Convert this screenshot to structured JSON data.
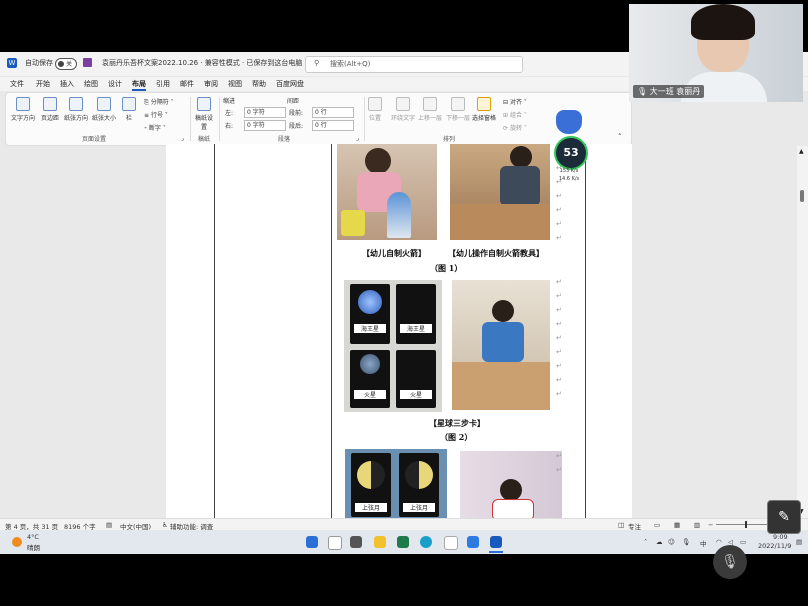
{
  "window": {
    "autosave_label": "自动保存",
    "autosave_state": "关",
    "doc_title": "袁丽丹乐吾杯文案2022.10.26 · 兼容性模式 · 已保存到这台电脑",
    "search_placeholder": "搜索(Alt+Q)"
  },
  "menu": [
    "文件",
    "开始",
    "插入",
    "绘图",
    "设计",
    "布局",
    "引用",
    "邮件",
    "审阅",
    "视图",
    "帮助",
    "百度网盘"
  ],
  "menu_active": "布局",
  "ribbon": {
    "page_setup": {
      "buttons": [
        "文字方向",
        "页边距",
        "纸张方向",
        "纸张大小",
        "栏"
      ],
      "side": [
        "分隔符",
        "行号",
        "断字"
      ],
      "group": "页面设置"
    },
    "manuscript": {
      "button": "稿纸设置",
      "group": "稿纸"
    },
    "indent": {
      "title": "缩进",
      "left_label": "左:",
      "left_value": "0 字符",
      "right_label": "右:",
      "right_value": "0 字符"
    },
    "spacing": {
      "title": "间距",
      "before_label": "段前:",
      "before_value": "0 行",
      "after_label": "段后:",
      "after_value": "0 行"
    },
    "paragraph_group": "段落",
    "arrange": {
      "buttons": [
        "位置",
        "环绕文字",
        "上移一层",
        "下移一层",
        "选择窗格"
      ],
      "side": [
        "对齐",
        "组合",
        "旋转"
      ],
      "group": "排列"
    }
  },
  "document": {
    "caption1_left": "【幼儿自制火箭】",
    "caption1_right": "【幼儿操作自制火箭教具】",
    "figure1": "（图 1）",
    "card_labels": [
      "海王星",
      "海王星",
      "火星",
      "火星"
    ],
    "caption2": "【星球三步卡】",
    "figure2": "（图 2）",
    "card_labels2": [
      "上弦月",
      "上弦月"
    ]
  },
  "status": {
    "page": "第 4 页，共 31 页",
    "words": "8196 个字",
    "lang": "中文(中国)",
    "accessibility": "辅助功能: 调查",
    "focus": "专注"
  },
  "taskbar": {
    "weather_temp": "4°C",
    "weather_desc": "晴朗",
    "ime": "中",
    "time": "9:09",
    "date": "2022/11/9"
  },
  "video": {
    "participant": "大一班 袁丽丹"
  },
  "gadget": {
    "value": "53",
    "up": "153 K/s",
    "down": "14.6 K/s"
  }
}
